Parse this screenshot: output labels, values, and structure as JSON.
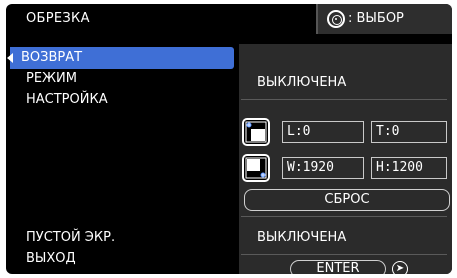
{
  "header": {
    "title": "ОБРЕЗКА",
    "right_label": ": ВЫБОР",
    "right_icon": "navigation-pad-icon"
  },
  "menu": {
    "items": [
      {
        "label": "ВОЗВРАТ",
        "selected": true
      },
      {
        "label": "РЕЖИМ",
        "selected": false
      },
      {
        "label": "НАСТРОЙКА",
        "selected": false
      },
      {
        "label": "ПУСТОЙ ЭКР.",
        "selected": false
      },
      {
        "label": "ВЫХОД",
        "selected": false
      }
    ]
  },
  "panel": {
    "mode_value": "ВЫКЛЮЧЕНА",
    "setting": {
      "top_left_icon": "top-left-corner-icon",
      "bottom_right_icon": "bottom-right-corner-icon",
      "l_field": "L:0",
      "t_field": "T:0",
      "w_field": "W:1920",
      "h_field": "H:1200",
      "reset_label": "СБРОС"
    },
    "blank_value": "ВЫКЛЮЧЕНА",
    "enter_label": "ENTER",
    "enter_icon": "enter-arrow-icon"
  },
  "colors": {
    "background": "#000000",
    "selection": "#3f6fd6",
    "panel": "#2b2b2b",
    "text": "#ffffff"
  }
}
